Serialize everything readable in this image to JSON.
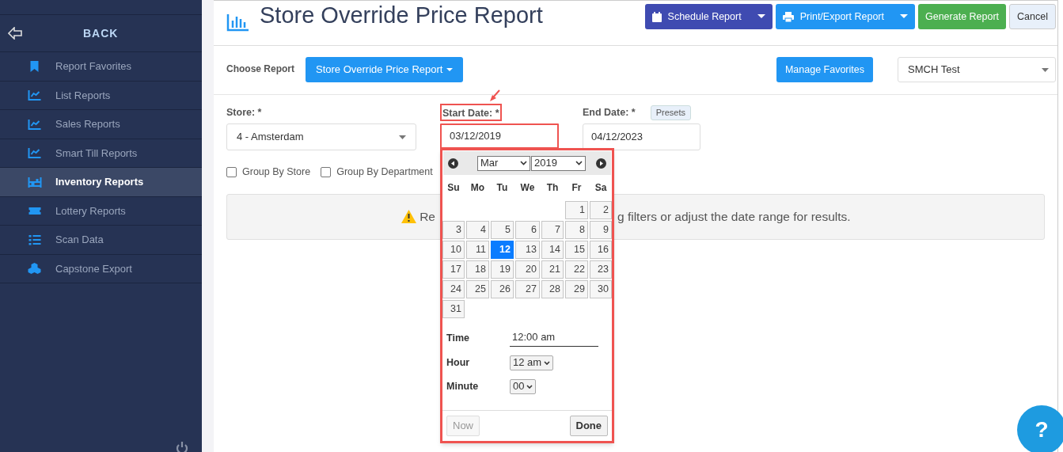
{
  "sidebar": {
    "back_label": "BACK",
    "items": [
      {
        "label": "Report Favorites",
        "kind": "bookmark",
        "selected": false
      },
      {
        "label": "List Reports",
        "kind": "chart",
        "selected": false
      },
      {
        "label": "Sales Reports",
        "kind": "chart",
        "selected": false
      },
      {
        "label": "Smart Till Reports",
        "kind": "chart",
        "selected": false
      },
      {
        "label": "Inventory Reports",
        "kind": "shelf",
        "selected": true
      },
      {
        "label": "Lottery Reports",
        "kind": "ticket",
        "selected": false
      },
      {
        "label": "Scan Data",
        "kind": "list",
        "selected": false
      },
      {
        "label": "Capstone Export",
        "kind": "cubes",
        "selected": false
      }
    ]
  },
  "header": {
    "title": "Store Override Price Report",
    "buttons": [
      {
        "label": "Schedule Report",
        "kind": "schedule",
        "dropdown": true
      },
      {
        "label": "Print/Export Report",
        "kind": "print",
        "dropdown": true
      },
      {
        "label": "Generate Report",
        "kind": "generate",
        "dropdown": false
      },
      {
        "label": "Cancel",
        "kind": "cancel",
        "dropdown": false
      }
    ]
  },
  "choose_report": {
    "label": "Choose Report",
    "value": "Store Override Price Report",
    "manage_button": "Manage Favorites",
    "favorite": "SMCH Test"
  },
  "filters": {
    "store": {
      "label": "Store: *",
      "value": "4 - Amsterdam"
    },
    "start_date": {
      "label": "Start Date: *",
      "value": "03/12/2019",
      "highlighted": true,
      "callout_arrow": true
    },
    "end_date": {
      "label": "End Date: *",
      "value": "04/12/2023",
      "presets": "Presets"
    },
    "checkboxes": [
      {
        "label": "Group By Store",
        "checked": false
      },
      {
        "label": "Group By Department",
        "checked": false
      }
    ]
  },
  "alert": {
    "text_before": "Re",
    "text_after": "g filters or adjust the date range for results."
  },
  "calendar": {
    "highlighted": true,
    "month": "Mar",
    "year": "2019",
    "weekdays": [
      "Su",
      "Mo",
      "Tu",
      "We",
      "Th",
      "Fr",
      "Sa"
    ],
    "weeks": [
      [
        {
          "label": "1",
          "selected": false
        },
        {
          "label": "2",
          "selected": false
        }
      ],
      [
        {
          "label": "3",
          "selected": false
        },
        {
          "label": "4",
          "selected": false
        },
        {
          "label": "5",
          "selected": false
        },
        {
          "label": "6",
          "selected": false
        },
        {
          "label": "7",
          "selected": false
        },
        {
          "label": "8",
          "selected": false
        },
        {
          "label": "9",
          "selected": false
        }
      ],
      [
        {
          "label": "10",
          "selected": false
        },
        {
          "label": "11",
          "selected": false
        },
        {
          "label": "12",
          "selected": true
        },
        {
          "label": "13",
          "selected": false
        },
        {
          "label": "14",
          "selected": false
        },
        {
          "label": "15",
          "selected": false
        },
        {
          "label": "16",
          "selected": false
        }
      ],
      [
        {
          "label": "17",
          "selected": false
        },
        {
          "label": "18",
          "selected": false
        },
        {
          "label": "19",
          "selected": false
        },
        {
          "label": "20",
          "selected": false
        },
        {
          "label": "21",
          "selected": false
        },
        {
          "label": "22",
          "selected": false
        },
        {
          "label": "23",
          "selected": false
        }
      ],
      [
        {
          "label": "24",
          "selected": false
        },
        {
          "label": "25",
          "selected": false
        },
        {
          "label": "26",
          "selected": false
        },
        {
          "label": "27",
          "selected": false
        },
        {
          "label": "28",
          "selected": false
        },
        {
          "label": "29",
          "selected": false
        },
        {
          "label": "30",
          "selected": false
        }
      ],
      [
        {
          "label": "31",
          "selected": false
        }
      ]
    ],
    "time_label": "Time",
    "time_value": "12:00 am",
    "hour_label": "Hour",
    "hour_value": "12 am",
    "minute_label": "Minute",
    "minute_value": "00",
    "now_button": {
      "label": "Now",
      "disabled": true
    },
    "done_button": {
      "label": "Done",
      "disabled": false
    }
  },
  "help_button": "?"
}
